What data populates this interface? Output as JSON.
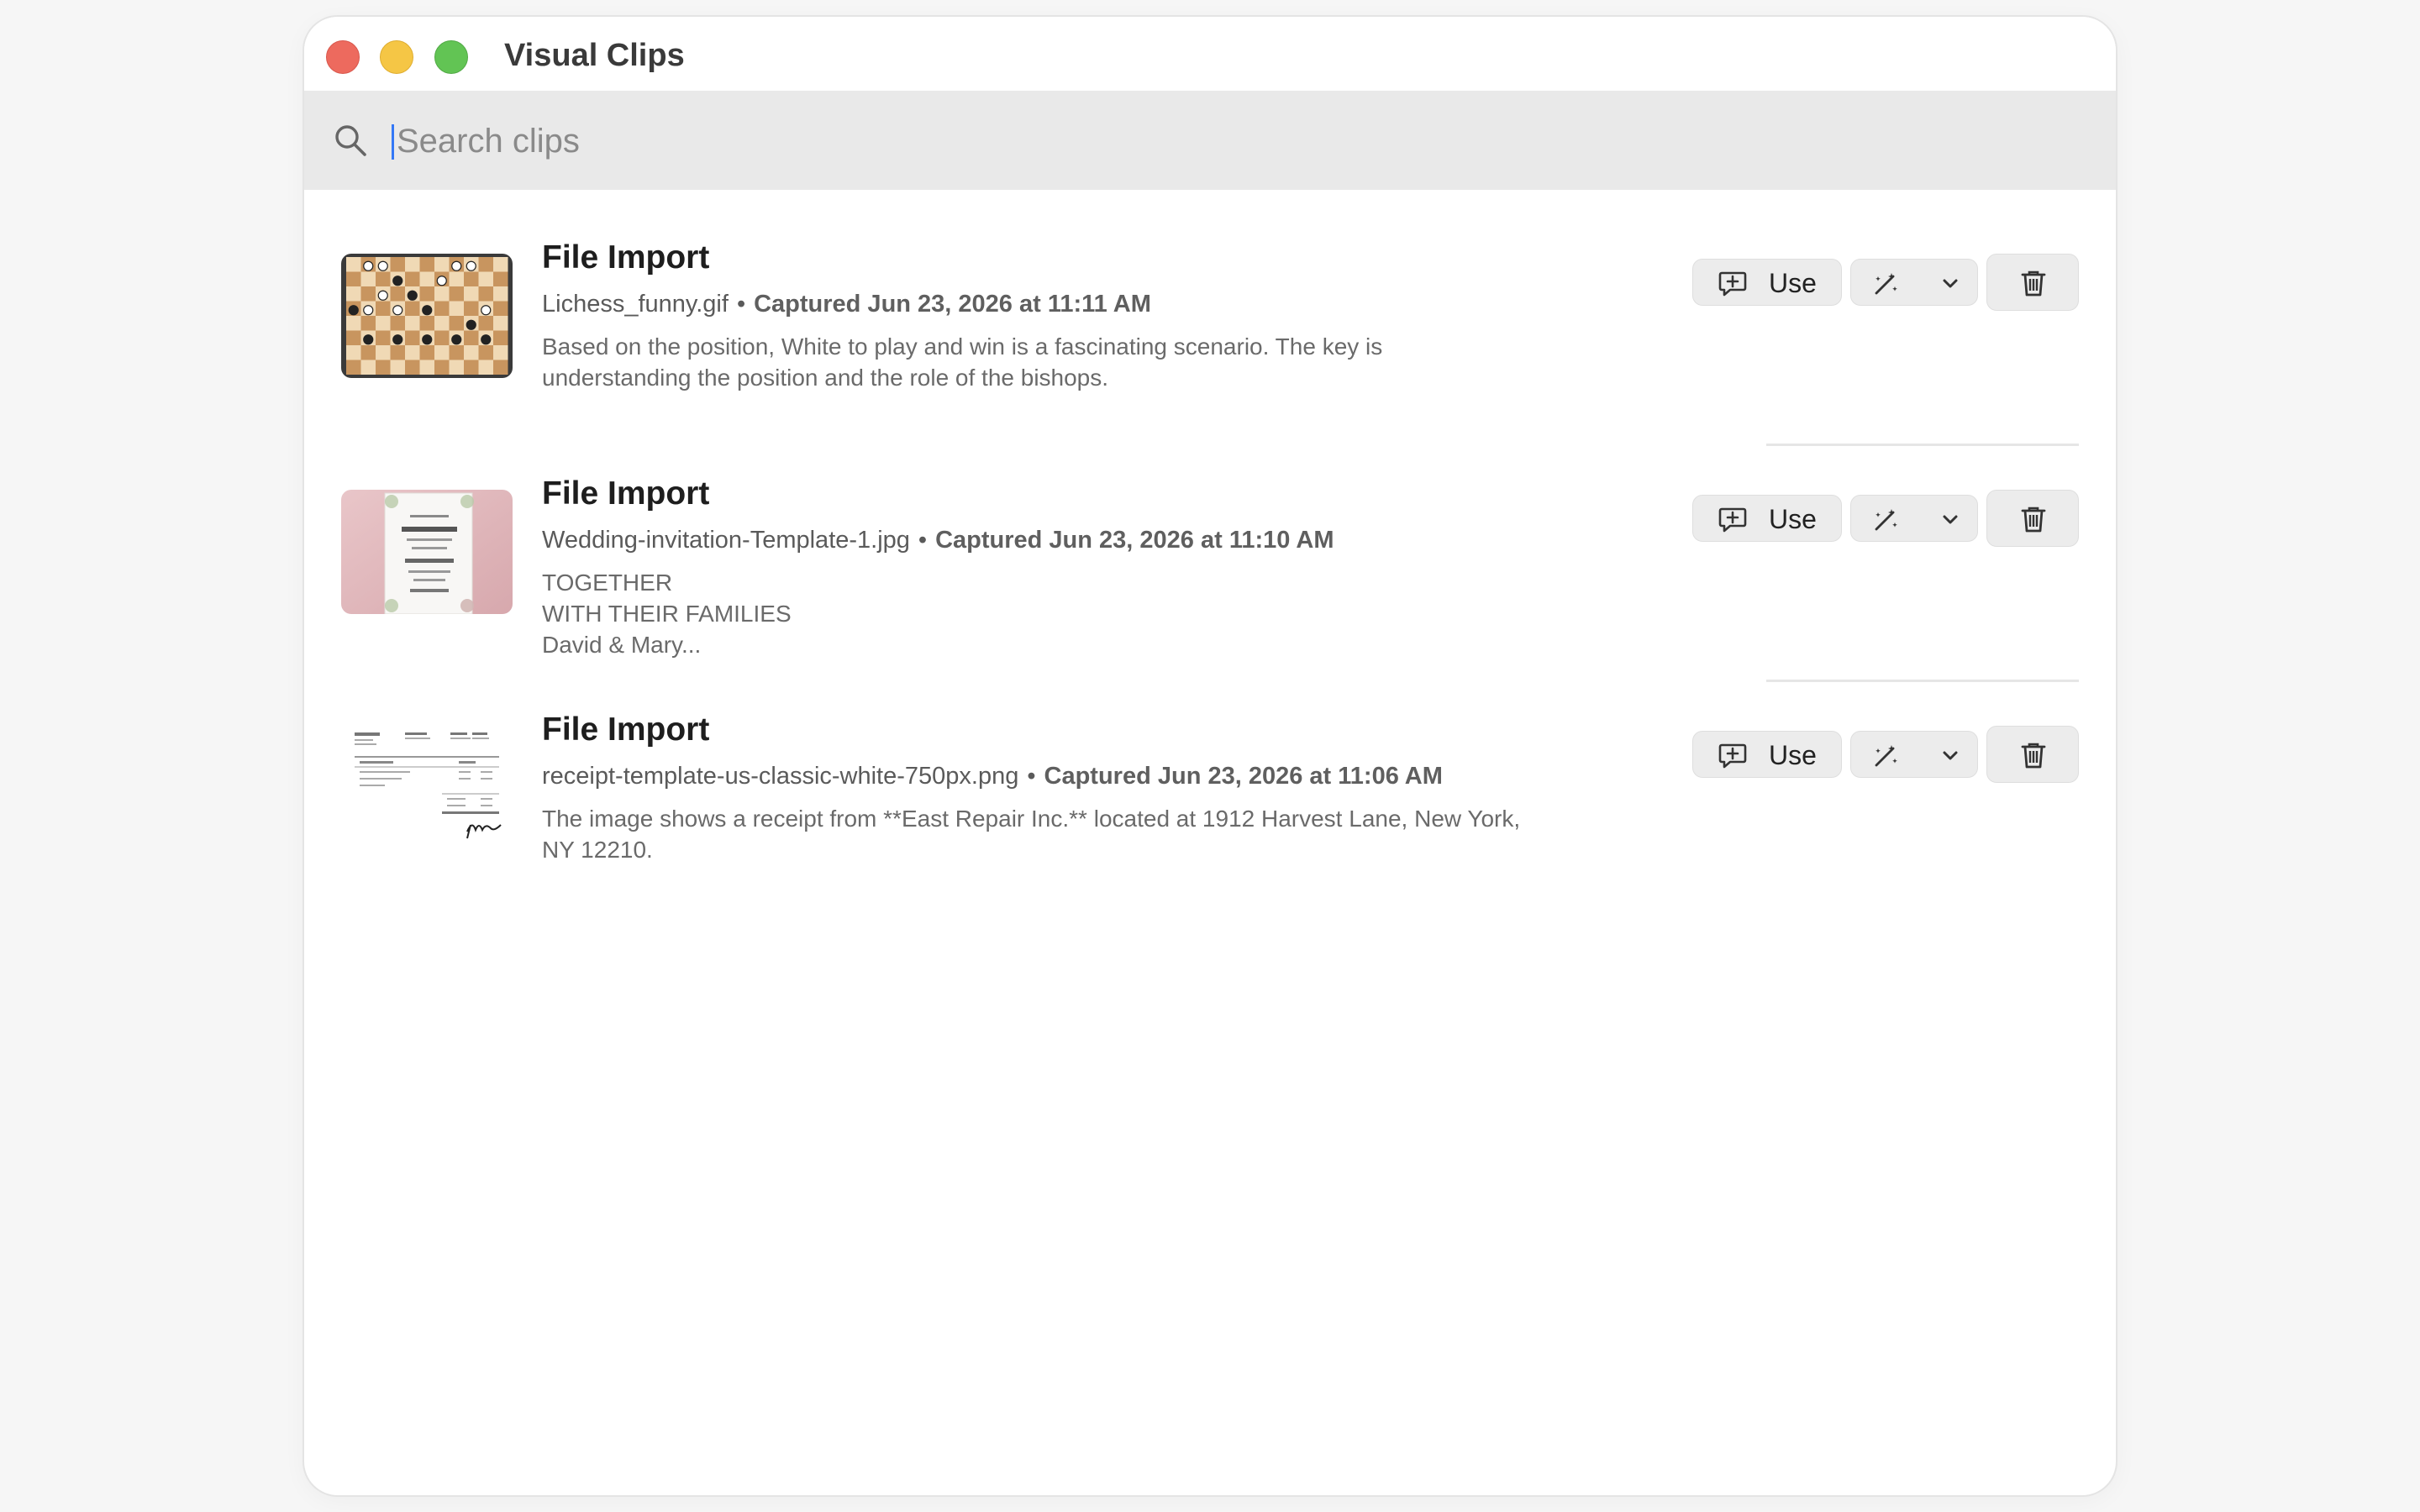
{
  "window": {
    "title": "Visual Clips"
  },
  "search": {
    "placeholder": "Search clips",
    "value": ""
  },
  "clips": [
    {
      "title": "File Import",
      "filename": "Lichess_funny.gif",
      "captured": "Captured Jun 23, 2026 at 11:11 AM",
      "description": "Based on the position, White to play and win is a fascinating scenario. The key is\nunderstanding the position and the role of the bishops.",
      "use_label": "Use"
    },
    {
      "title": "File Import",
      "filename": "Wedding-invitation-Template-1.jpg",
      "captured": "Captured Jun 23, 2026 at 11:10 AM",
      "description": "TOGETHER\nWITH THEIR FAMILIES\nDavid & Mary...",
      "use_label": "Use"
    },
    {
      "title": "File Import",
      "filename": "receipt-template-us-classic-white-750px.png",
      "captured": "Captured Jun 23, 2026 at 11:06 AM",
      "description": "The image shows a receipt from **East Repair Inc.** located at 1912 Harvest Lane, New York,\nNY 12210.",
      "use_label": "Use"
    }
  ],
  "separator": "•",
  "icons": {
    "search": "search-icon",
    "use": "add-comment-icon",
    "magic": "magic-wand-icon",
    "more": "chevron-down-icon",
    "delete": "trash-icon"
  },
  "colors": {
    "close": "#ed6a5e",
    "minimize": "#f5c645",
    "maximize": "#62c454",
    "accent": "#3478f6"
  }
}
